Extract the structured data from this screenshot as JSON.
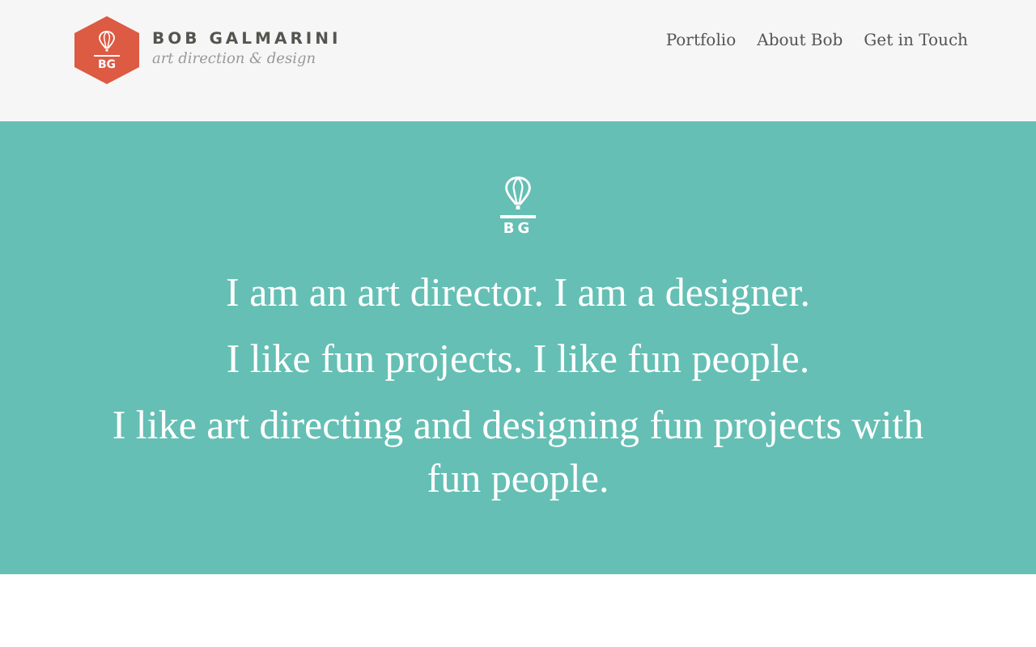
{
  "brand": {
    "logo_initials": "BG",
    "name": "BOB GALMARINI",
    "tagline": "art direction & design"
  },
  "nav": [
    {
      "label": "Portfolio"
    },
    {
      "label": "About Bob"
    },
    {
      "label": "Get in Touch"
    }
  ],
  "hero": {
    "logo_initials": "BG",
    "lines": [
      "I am an art director. I am a designer.",
      "I like fun projects. I like fun people.",
      "I like art directing and designing fun projects with fun people."
    ]
  }
}
